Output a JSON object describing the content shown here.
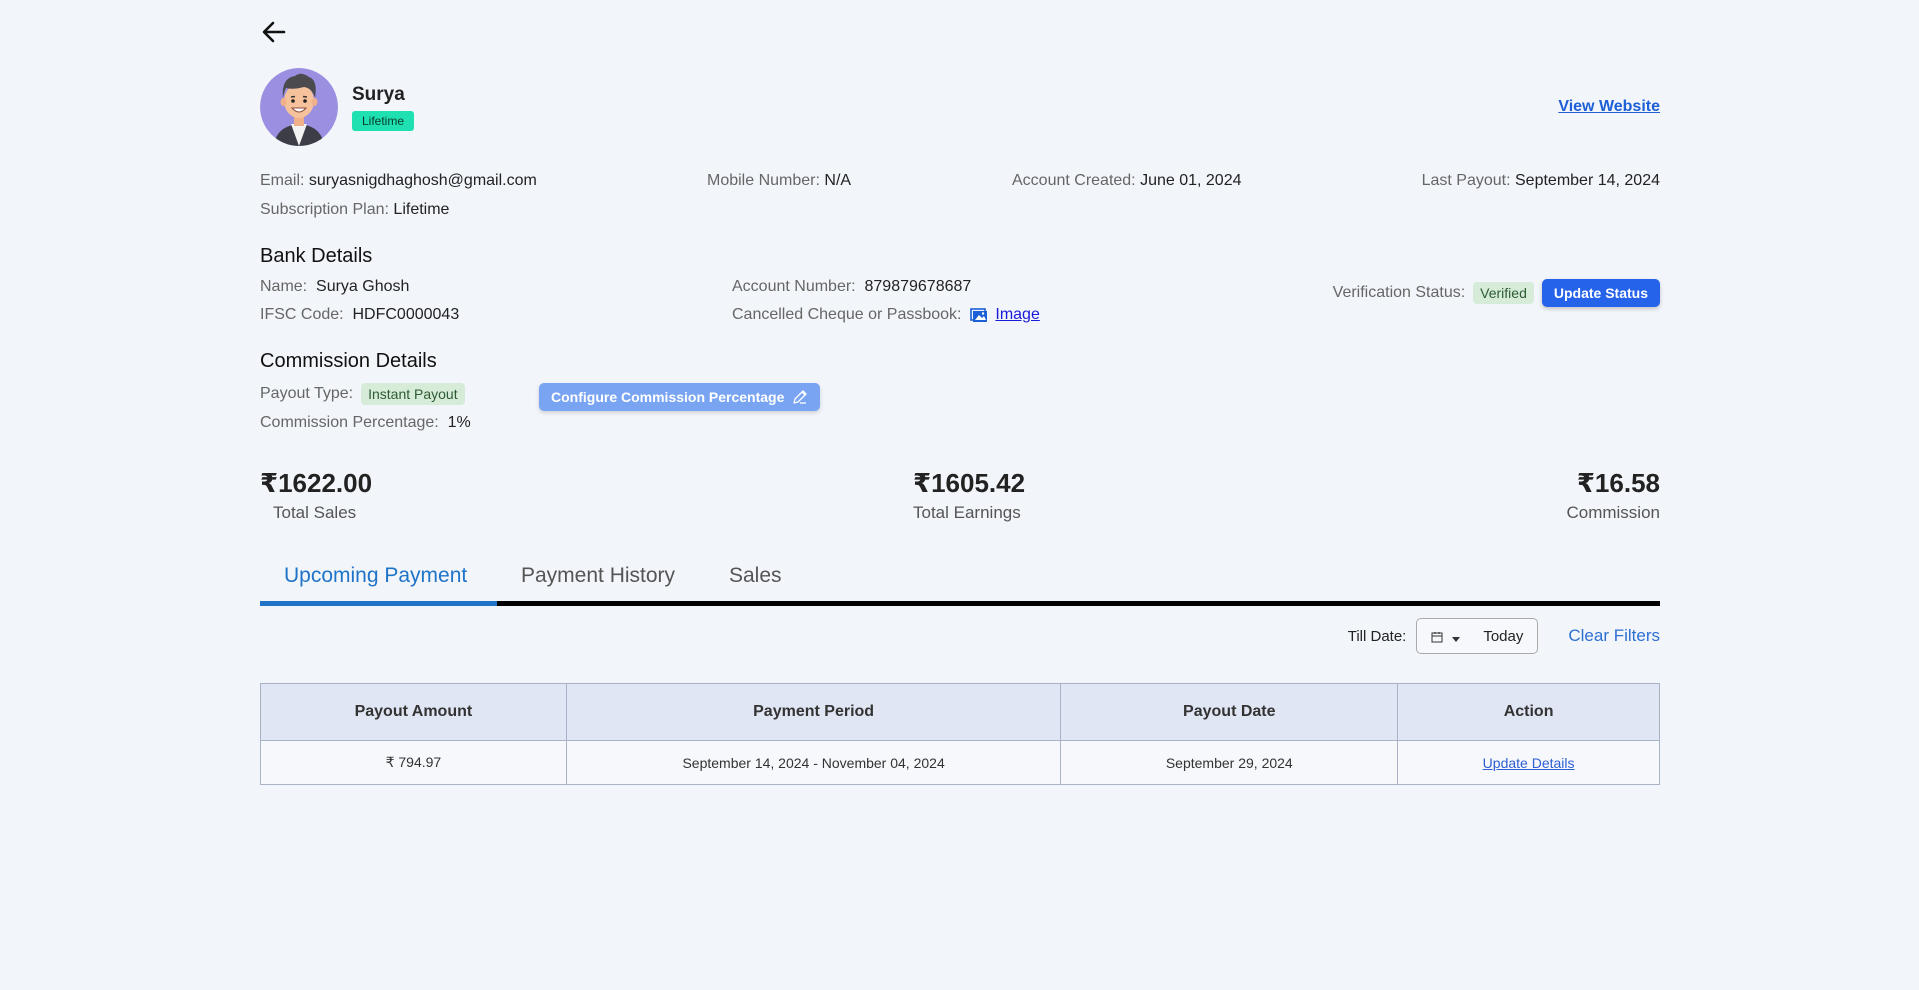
{
  "profile": {
    "name": "Surya",
    "plan_badge": "Lifetime",
    "view_website": "View Website"
  },
  "info": {
    "email_label": "Email:",
    "email": "suryasnigdhaghosh@gmail.com",
    "mobile_label": "Mobile Number:",
    "mobile": "N/A",
    "created_label": "Account Created:",
    "created": "June 01, 2024",
    "last_payout_label": "Last Payout:",
    "last_payout": "September 14, 2024",
    "subscription_label": "Subscription Plan:",
    "subscription": "Lifetime"
  },
  "bank": {
    "title": "Bank Details",
    "name_label": "Name:",
    "name": "Surya Ghosh",
    "ifsc_label": "IFSC Code:",
    "ifsc": "HDFC0000043",
    "account_label": "Account Number:",
    "account": "879879678687",
    "cheque_label": "Cancelled Cheque or Passbook:",
    "cheque_link": "Image",
    "verification_label": "Verification Status:",
    "verification_status": "Verified",
    "update_status": "Update Status"
  },
  "commission": {
    "title": "Commission Details",
    "payout_type_label": "Payout Type:",
    "payout_type": "Instant Payout",
    "percentage_label": "Commission Percentage:",
    "percentage": "1%",
    "configure_button": "Configure Commission Percentage"
  },
  "stats": {
    "total_sales": "₹1622.00",
    "total_sales_label": "Total Sales",
    "total_earnings": "₹1605.42",
    "total_earnings_label": "Total Earnings",
    "commission": "₹16.58",
    "commission_label": "Commission"
  },
  "tabs": [
    {
      "label": "Upcoming Payment",
      "active": true
    },
    {
      "label": "Payment History",
      "active": false
    },
    {
      "label": "Sales",
      "active": false
    }
  ],
  "filters": {
    "till_date_label": "Till Date:",
    "till_date_value": "Today",
    "clear_filters": "Clear Filters"
  },
  "table": {
    "headers": [
      "Payout Amount",
      "Payment Period",
      "Payout Date",
      "Action"
    ],
    "rows": [
      {
        "amount": "₹ 794.97",
        "period": "September 14, 2024 - November 04, 2024",
        "date": "September 29, 2024",
        "action": "Update Details"
      }
    ]
  },
  "colors": {
    "background": "#f2f5fa",
    "accent": "#1f74c8",
    "primary_button": "#2563eb",
    "plan_badge": "#1ee0b0"
  }
}
